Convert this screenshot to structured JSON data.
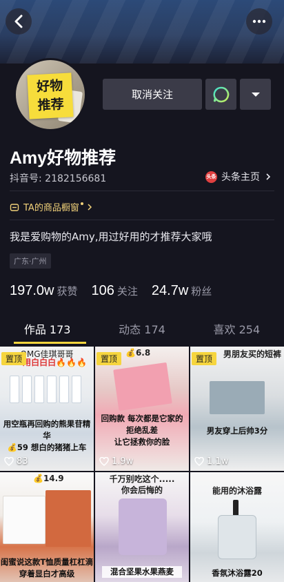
{
  "header": {
    "back_icon": "chevron-left-icon",
    "more_icon": "more-dots-icon"
  },
  "profile": {
    "avatar_text_line1": "好物",
    "avatar_text_line2": "推荐",
    "unfollow_label": "取消关注",
    "name": "Amy好物推荐",
    "douyin_id": "抖音号: 2182156681",
    "toutiao_badge": "头条",
    "toutiao_label": "头条主页",
    "shop_label": "TA的商品橱窗",
    "bio": "我是爱购物的Amy,用过好用的才推荐大家哦",
    "location": "广东·广州"
  },
  "stats": [
    {
      "num": "197.0w",
      "label": "获赞"
    },
    {
      "num": "106",
      "label": "关注"
    },
    {
      "num": "24.7w",
      "label": "粉丝"
    }
  ],
  "tabs": [
    {
      "label": "作品 173"
    },
    {
      "label": "动态 174"
    },
    {
      "label": "喜欢 254"
    }
  ],
  "videos": [
    {
      "pinned": "置顶",
      "top": "OMG佳琪哥哥",
      "top2": "用白白白🔥🔥🔥",
      "caption": "用空瓶再回购的熊果苷精华\n💰59 想白的猪猪上车",
      "likes": "83"
    },
    {
      "pinned": "置顶",
      "top": "💰6.8",
      "caption": "回购款 每次都是它家的\n拒绝乱差\n让它拯救你的脸",
      "likes": "1.9w"
    },
    {
      "pinned": "置顶",
      "top": "男朋友买的短裤",
      "caption": "男友穿上后帅3分",
      "likes": "1.1w"
    },
    {
      "pinned": "",
      "top": "💰14.9",
      "caption": "闺蜜说这款T恤质量杠杠滴\n穿着显白才高级",
      "likes": ""
    },
    {
      "pinned": "",
      "top": "千万别吃这个.....\n你会后悔的",
      "caption": "混合坚果水果燕麦",
      "likes": ""
    },
    {
      "pinned": "",
      "top": "能用的沐浴露",
      "caption": "香氛沐浴露20",
      "likes": ""
    }
  ],
  "colors": {
    "background": "#15151f",
    "accent": "#f6d53e",
    "button": "#3b3b48",
    "shop": "#f2d27a"
  }
}
